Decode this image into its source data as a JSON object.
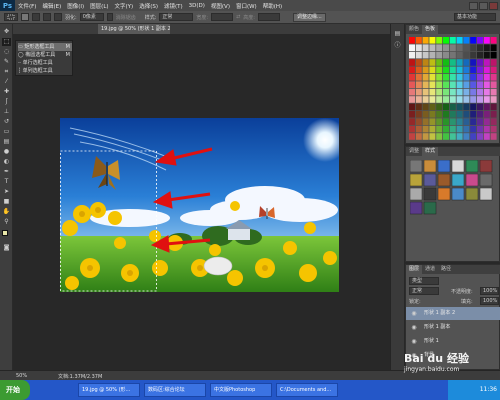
{
  "app": {
    "logo": "Ps"
  },
  "menu": [
    "文件(F)",
    "编辑(E)",
    "图像(I)",
    "图层(L)",
    "文字(Y)",
    "选择(S)",
    "滤镜(T)",
    "3D(D)",
    "视图(V)",
    "窗口(W)",
    "帮助(H)"
  ],
  "options_bar": {
    "feather_label": "羽化:",
    "feather_value": "0像素",
    "antialias_label": "消除锯齿",
    "style_label": "样式:",
    "style_value": "正常",
    "width_label": "宽度:",
    "height_label": "高度:",
    "refine_edge_button": "调整边缘...",
    "workspace_button": "基本功能"
  },
  "document": {
    "tab_title": "19.jpg @ 50% (形状 1 副本 2, RGB/8#) *",
    "zoom": "50%",
    "status": "文档:1.37M/2.37M"
  },
  "tool_flyout": {
    "items": [
      "矩形选框工具",
      "椭圆选框工具",
      "单行选框工具",
      "单列选框工具"
    ],
    "shortcut": "M",
    "selected_index": 0
  },
  "panels": {
    "color": {
      "tabs": [
        "颜色",
        "色板"
      ],
      "active": 1
    },
    "styles": {
      "tabs": [
        "调整",
        "样式"
      ],
      "active": 1
    },
    "layers": {
      "tabs": [
        "图层",
        "通道",
        "路径"
      ],
      "active": 0,
      "kind_label": "类型",
      "blend_mode": "正常",
      "opacity_label": "不透明度:",
      "opacity_value": "100%",
      "lock_label": "锁定:",
      "fill_label": "填充:",
      "fill_value": "100%",
      "items": [
        "形状 1 副本 2",
        "形状 1 副本",
        "形状 1",
        "背景"
      ],
      "selected_index": 0
    }
  },
  "taskbar": {
    "start_label": "开始",
    "tasks": [
      "19.jpg @ 50% (形...",
      "数码区:综合论坛",
      "中文版Photoshop",
      "C:\\Documents and..."
    ],
    "clock": "11:36"
  },
  "watermark": {
    "brand": "Bai du 经验",
    "url": "jingyan.baidu.com"
  }
}
